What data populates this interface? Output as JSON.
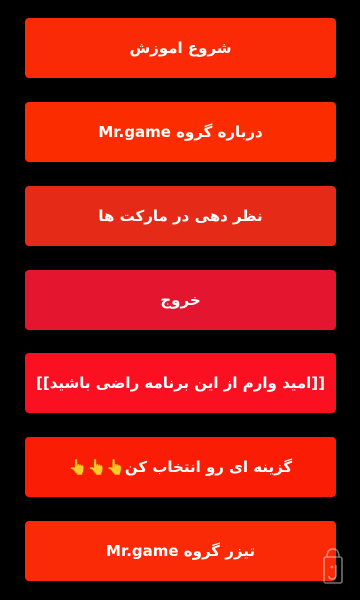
{
  "menu": {
    "items": [
      {
        "label": "شروع اموزش"
      },
      {
        "label": "درباره گروه Mr.game"
      },
      {
        "label": "نظر دهی در مارکت ها"
      },
      {
        "label": "خروج"
      },
      {
        "label": "[[امید وارم از این برنامه راضی باشید]]"
      },
      {
        "label": "گزینه ای رو انتخاب کن👆👆👆"
      },
      {
        "label": "تیزر گروه Mr.game"
      }
    ]
  },
  "colors": {
    "background": "#000000",
    "button_text": "#ffffff",
    "buttons": [
      "#fb2a06",
      "#fb2d00",
      "#e52a17",
      "#e4152e",
      "#fa1020",
      "#fb1c06",
      "#fb2a06"
    ]
  },
  "watermark": {
    "icon": "bazaar-bag-icon"
  }
}
